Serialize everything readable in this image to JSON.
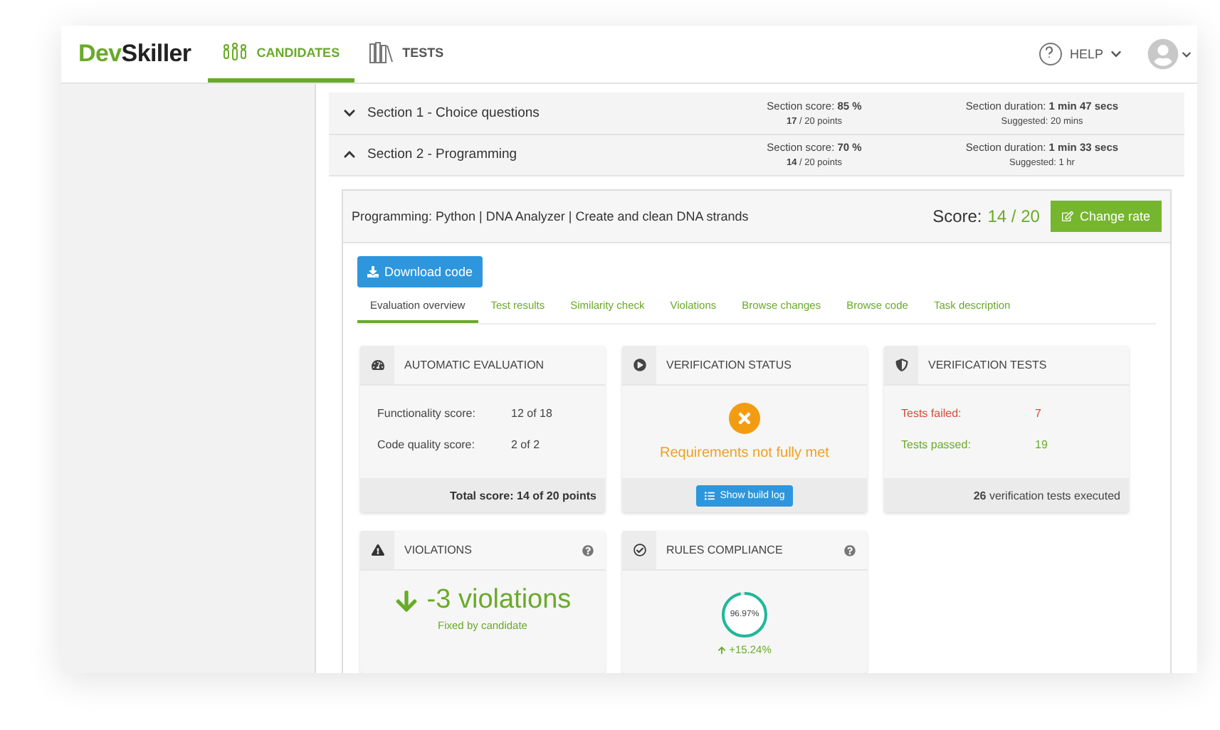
{
  "header": {
    "logo": [
      "Dev",
      "Skiller"
    ],
    "nav": [
      {
        "label": "CANDIDATES",
        "selected": true
      },
      {
        "label": "TESTS",
        "selected": false
      }
    ],
    "help": "HELP"
  },
  "sections": [
    {
      "title": "Section 1 - Choice questions",
      "expanded": false,
      "score": "Section score: **85 %**",
      "points": "**17** / 20 points",
      "duration": "Section duration: **1 min 47 secs**",
      "suggested": "Suggested: 20 mins"
    },
    {
      "title": "Section 2 - Programming",
      "expanded": true,
      "score": "Section score: **70 %**",
      "points": "**14** / 20 points",
      "duration": "Section duration: **1 min 33 secs**",
      "suggested": "Suggested: 1 hr"
    }
  ],
  "task": {
    "title": "Programming: Python | DNA Analyzer | Create and clean DNA strands",
    "score_label": "Score:",
    "score_value": "14 / 20",
    "change_button": "Change rate",
    "download_button": "Download code",
    "tabs": [
      {
        "label": "Evaluation overview",
        "selected": true
      },
      {
        "label": "Test results",
        "selected": false
      },
      {
        "label": "Similarity check",
        "selected": false
      },
      {
        "label": "Violations",
        "selected": false
      },
      {
        "label": "Browse changes",
        "selected": false
      },
      {
        "label": "Browse code",
        "selected": false
      },
      {
        "label": "Task description",
        "selected": false
      }
    ]
  },
  "automatic_evaluation": {
    "title": "AUTOMATIC EVALUATION",
    "rows": [
      {
        "label": "Functionality score:",
        "value": "12 of 18"
      },
      {
        "label": "Code quality score:",
        "value": "2 of 2"
      }
    ],
    "footer": "Total score: 14 of 20 points"
  },
  "verification_status": {
    "title": "VERIFICATION STATUS",
    "message": "Requirements not fully met",
    "button": "Show build log"
  },
  "verification_tests": {
    "title": "VERIFICATION TESTS",
    "rows": [
      {
        "label": "Tests failed:",
        "value": "7",
        "color": "#e0463c"
      },
      {
        "label": "Tests passed:",
        "value": "19",
        "color": "#6aaa2a"
      }
    ],
    "footer": "**26** verification tests executed"
  },
  "violations": {
    "title": "VIOLATIONS",
    "value": "-3 violations",
    "caption": "Fixed by candidate"
  },
  "rules_compliance": {
    "title": "RULES COMPLIANCE",
    "gauge": {
      "reading": "96.97%",
      "level": 0.9697
    },
    "change": "+15.24%"
  }
}
